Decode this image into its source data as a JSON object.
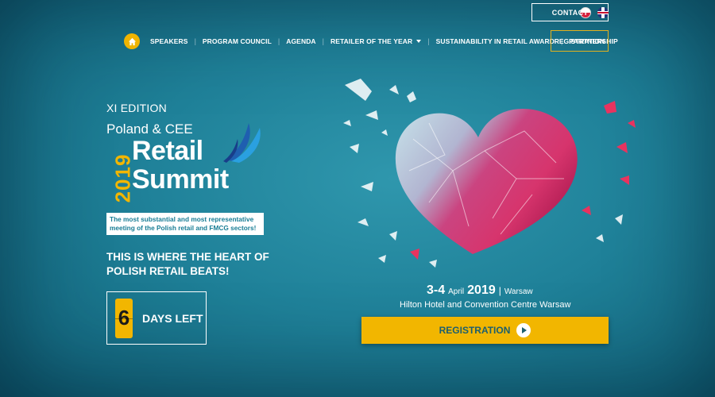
{
  "top": {
    "contact_label": "CONTACT",
    "languages": [
      {
        "code": "pl",
        "icon": "poland-flag-icon"
      },
      {
        "code": "en",
        "icon": "uk-flag-icon"
      }
    ]
  },
  "nav": {
    "home_icon": "home-icon",
    "items": [
      "SPEAKERS",
      "PROGRAM COUNCIL",
      "AGENDA",
      "RETAILER OF THE YEAR",
      "SUSTAINABILITY IN RETAIL AWARD",
      "PARTNERSHIP"
    ],
    "registration_label": "REGISTRATION"
  },
  "hero": {
    "edition": "XI EDITION",
    "logo_top": "Poland & CEE",
    "logo_year": "2019",
    "logo_word1": "Retail",
    "logo_word2": "Summit",
    "tagline": "The most substantial and most representative meeting of the Polish retail and FMCG sectors!",
    "headline_line1": "THIS IS WHERE THE HEART OF",
    "headline_line2": "POLISH RETAIL BEATS!",
    "countdown_value": "6",
    "countdown_label": "DAYS LEFT"
  },
  "event": {
    "days": "3-4",
    "month": "April",
    "year": "2019",
    "city": "Warsaw",
    "venue": "Hilton Hotel and Convention Centre Warsaw",
    "cta_label": "REGISTRATION"
  },
  "colors": {
    "accent": "#f2b600",
    "background": "#1f8199",
    "text_on_white": "#187d95"
  }
}
